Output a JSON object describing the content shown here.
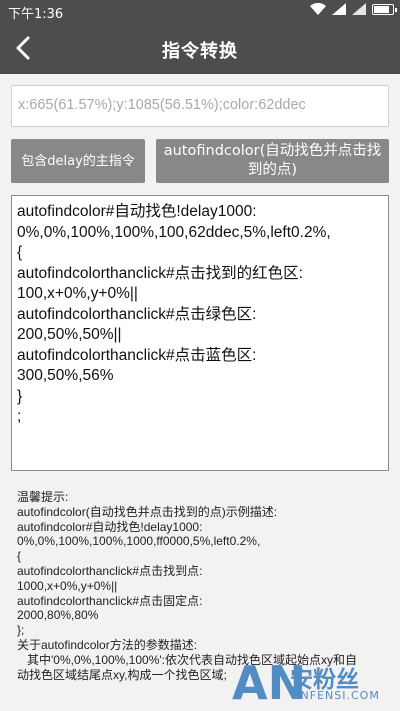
{
  "status_bar": {
    "time": "下午1:36"
  },
  "header": {
    "title": "指令转换"
  },
  "input": {
    "value": "x:665(61.57%);y:1085(56.51%);color:62ddec"
  },
  "buttons": {
    "main_cmd": "包含delay的主指令",
    "autofindcolor": "autofindcolor(自动找色并点击找到的点)"
  },
  "code_lines": [
    "autofindcolor#自动找色!delay1000:",
    "0%,0%,100%,100%,100,62ddec,5%,left0.2%,",
    "{",
    "autofindcolorthanclick#点击找到的红色区:",
    "100,x+0%,y+0%||",
    "autofindcolorthanclick#点击绿色区:",
    "200,50%,50%||",
    "autofindcolorthanclick#点击蓝色区:",
    "300,50%,56%",
    "}",
    "",
    ";"
  ],
  "tips_lines": [
    "温馨提示:",
    "autofindcolor(自动找色并点击找到的点)示例描述:",
    "",
    "autofindcolor#自动找色!delay1000:",
    "0%,0%,100%,100%,1000,ff0000,5%,left0.2%,",
    "{",
    "autofindcolorthanclick#点击找到点:",
    "1000,x+0%,y+0%||",
    "autofindcolorthanclick#点击固定点:",
    "2000,80%,80%",
    "};",
    "关于autofindcolor方法的参数描述:",
    "   其中'0%,0%,100%,100%':依次代表自动找色区域起始点xy和自",
    "动找色区域结尾点xy,构成一个找色区域;"
  ],
  "watermark": {
    "letters": "AN",
    "name": "安粉丝",
    "domain": "ANFENSI.COM"
  }
}
